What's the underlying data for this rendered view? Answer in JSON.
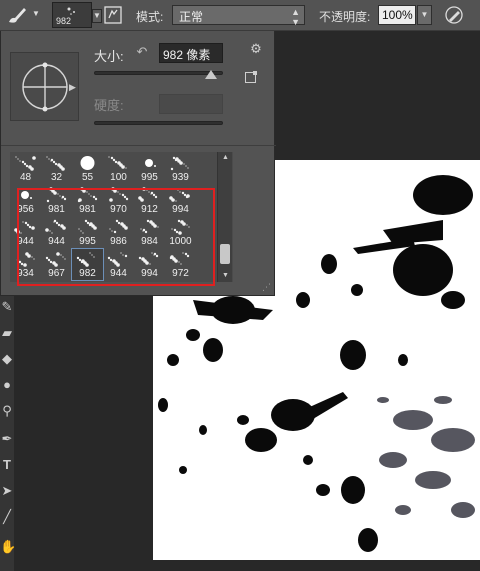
{
  "options_bar": {
    "brush_size_value": "982",
    "mode_label": "模式:",
    "mode_value": "正常",
    "opacity_label": "不透明度:",
    "opacity_value": "100%"
  },
  "brush_panel": {
    "size_label": "大小:",
    "size_value": "982 像素",
    "size_slider_fraction": 0.9,
    "hardness_label": "硬度:",
    "hardness_value": ""
  },
  "brush_presets": [
    {
      "size": "48"
    },
    {
      "size": "32"
    },
    {
      "size": "55"
    },
    {
      "size": "100"
    },
    {
      "size": "995"
    },
    {
      "size": "939"
    },
    {
      "size": "956"
    },
    {
      "size": "981"
    },
    {
      "size": "981"
    },
    {
      "size": "970"
    },
    {
      "size": "912"
    },
    {
      "size": "994"
    },
    {
      "size": "944"
    },
    {
      "size": "944"
    },
    {
      "size": "995"
    },
    {
      "size": "986"
    },
    {
      "size": "984"
    },
    {
      "size": "1000"
    },
    {
      "size": "934"
    },
    {
      "size": "967"
    },
    {
      "size": "982",
      "selected": true
    },
    {
      "size": "944"
    },
    {
      "size": "994"
    },
    {
      "size": "972"
    }
  ],
  "icons": {
    "brush_tool": "brush-icon",
    "panel_toggle": "brush-panel-icon",
    "airbrush": "airbrush-icon",
    "reset": "reset-icon",
    "gear": "gear-icon",
    "new_preset": "new-preset-icon"
  },
  "colors": {
    "highlight": "#e02020",
    "panel_bg": "#535353",
    "workspace_bg": "#282828"
  }
}
